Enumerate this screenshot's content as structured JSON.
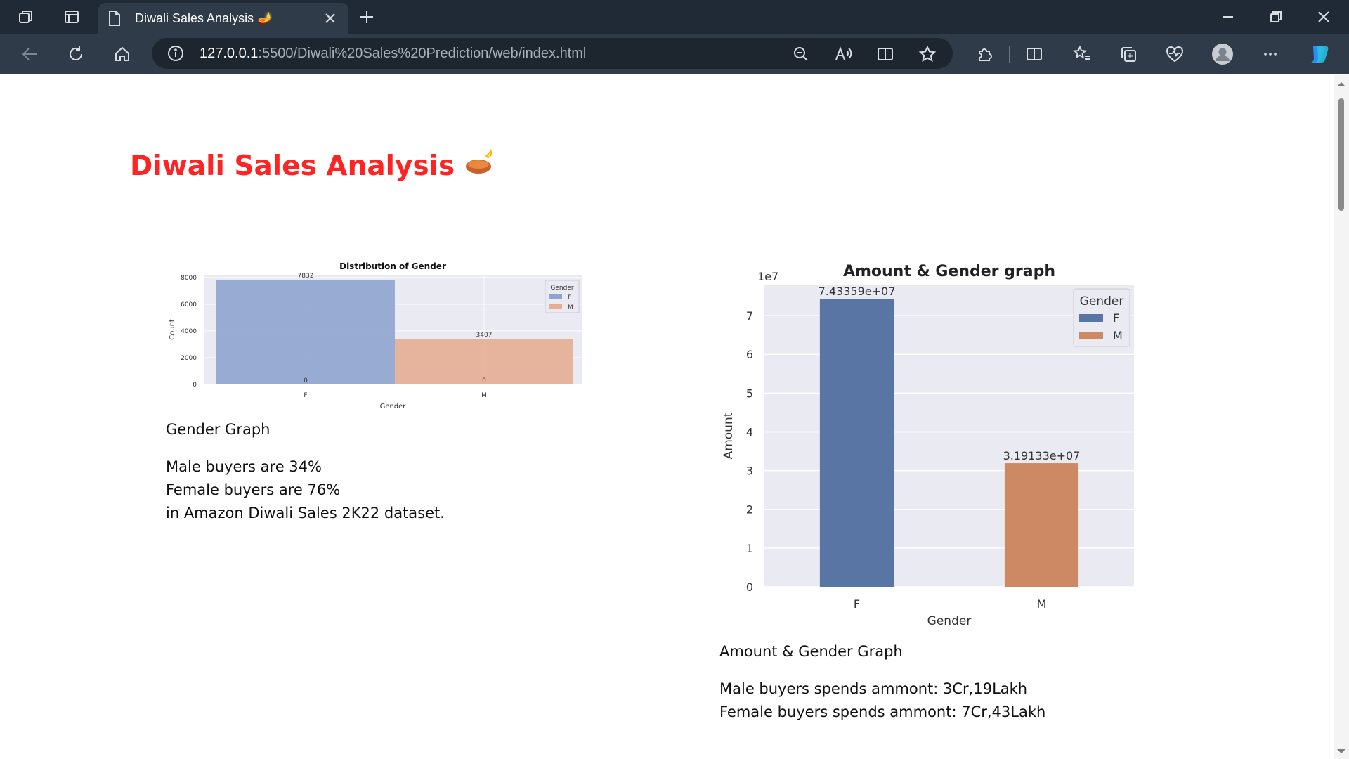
{
  "browser": {
    "tab_title": "Diwali Sales Analysis 🪔",
    "url_host": "127.0.0.1",
    "url_path": ":5500/Diwali%20Sales%20Prediction/web/index.html"
  },
  "page": {
    "title": "Diwali Sales Analysis",
    "title_color": "#ff2424"
  },
  "section_left": {
    "caption_title": "Gender Graph",
    "lines": [
      "Male buyers are 34%",
      "Female buyers are 76%",
      "in Amazon Diwali Sales 2K22 dataset."
    ]
  },
  "section_right": {
    "caption_title": "Amount & Gender Graph",
    "lines": [
      "Male buyers spends ammont: 3Cr,19Lakh",
      "Female buyers spends ammont: 7Cr,43Lakh"
    ]
  },
  "chart_data": [
    {
      "type": "bar",
      "title": "Distribution of Gender",
      "xlabel": "Gender",
      "ylabel": "Count",
      "categories": [
        "F",
        "M"
      ],
      "series": [
        {
          "name": "F",
          "values": [
            7832,
            0
          ],
          "color": "#8fa4cf"
        },
        {
          "name": "M",
          "values": [
            0,
            3407
          ],
          "color": "#e6ad94"
        }
      ],
      "bar_labels": [
        "7832",
        "3407"
      ],
      "zero_labels": [
        "0",
        "0"
      ],
      "yticks": [
        0,
        2000,
        4000,
        6000,
        8000
      ],
      "ylim": [
        0,
        8200
      ],
      "legend_title": "Gender",
      "legend": "top-right",
      "grid": true
    },
    {
      "type": "bar",
      "title": "Amount & Gender graph",
      "xlabel": "Gender",
      "ylabel": "Amount",
      "offset_label": "1e7",
      "categories": [
        "F",
        "M"
      ],
      "series": [
        {
          "name": "F",
          "values": [
            74335900
          ],
          "color": "#5875a4"
        },
        {
          "name": "M",
          "values": [
            31913300
          ],
          "color": "#cc8963"
        }
      ],
      "bar_labels": [
        "7.43359e+07",
        "3.19133e+07"
      ],
      "yticks": [
        0,
        1,
        2,
        3,
        4,
        5,
        6,
        7
      ],
      "ylim": [
        0,
        7.8
      ],
      "legend_title": "Gender",
      "legend": "top-right",
      "grid": true
    }
  ]
}
